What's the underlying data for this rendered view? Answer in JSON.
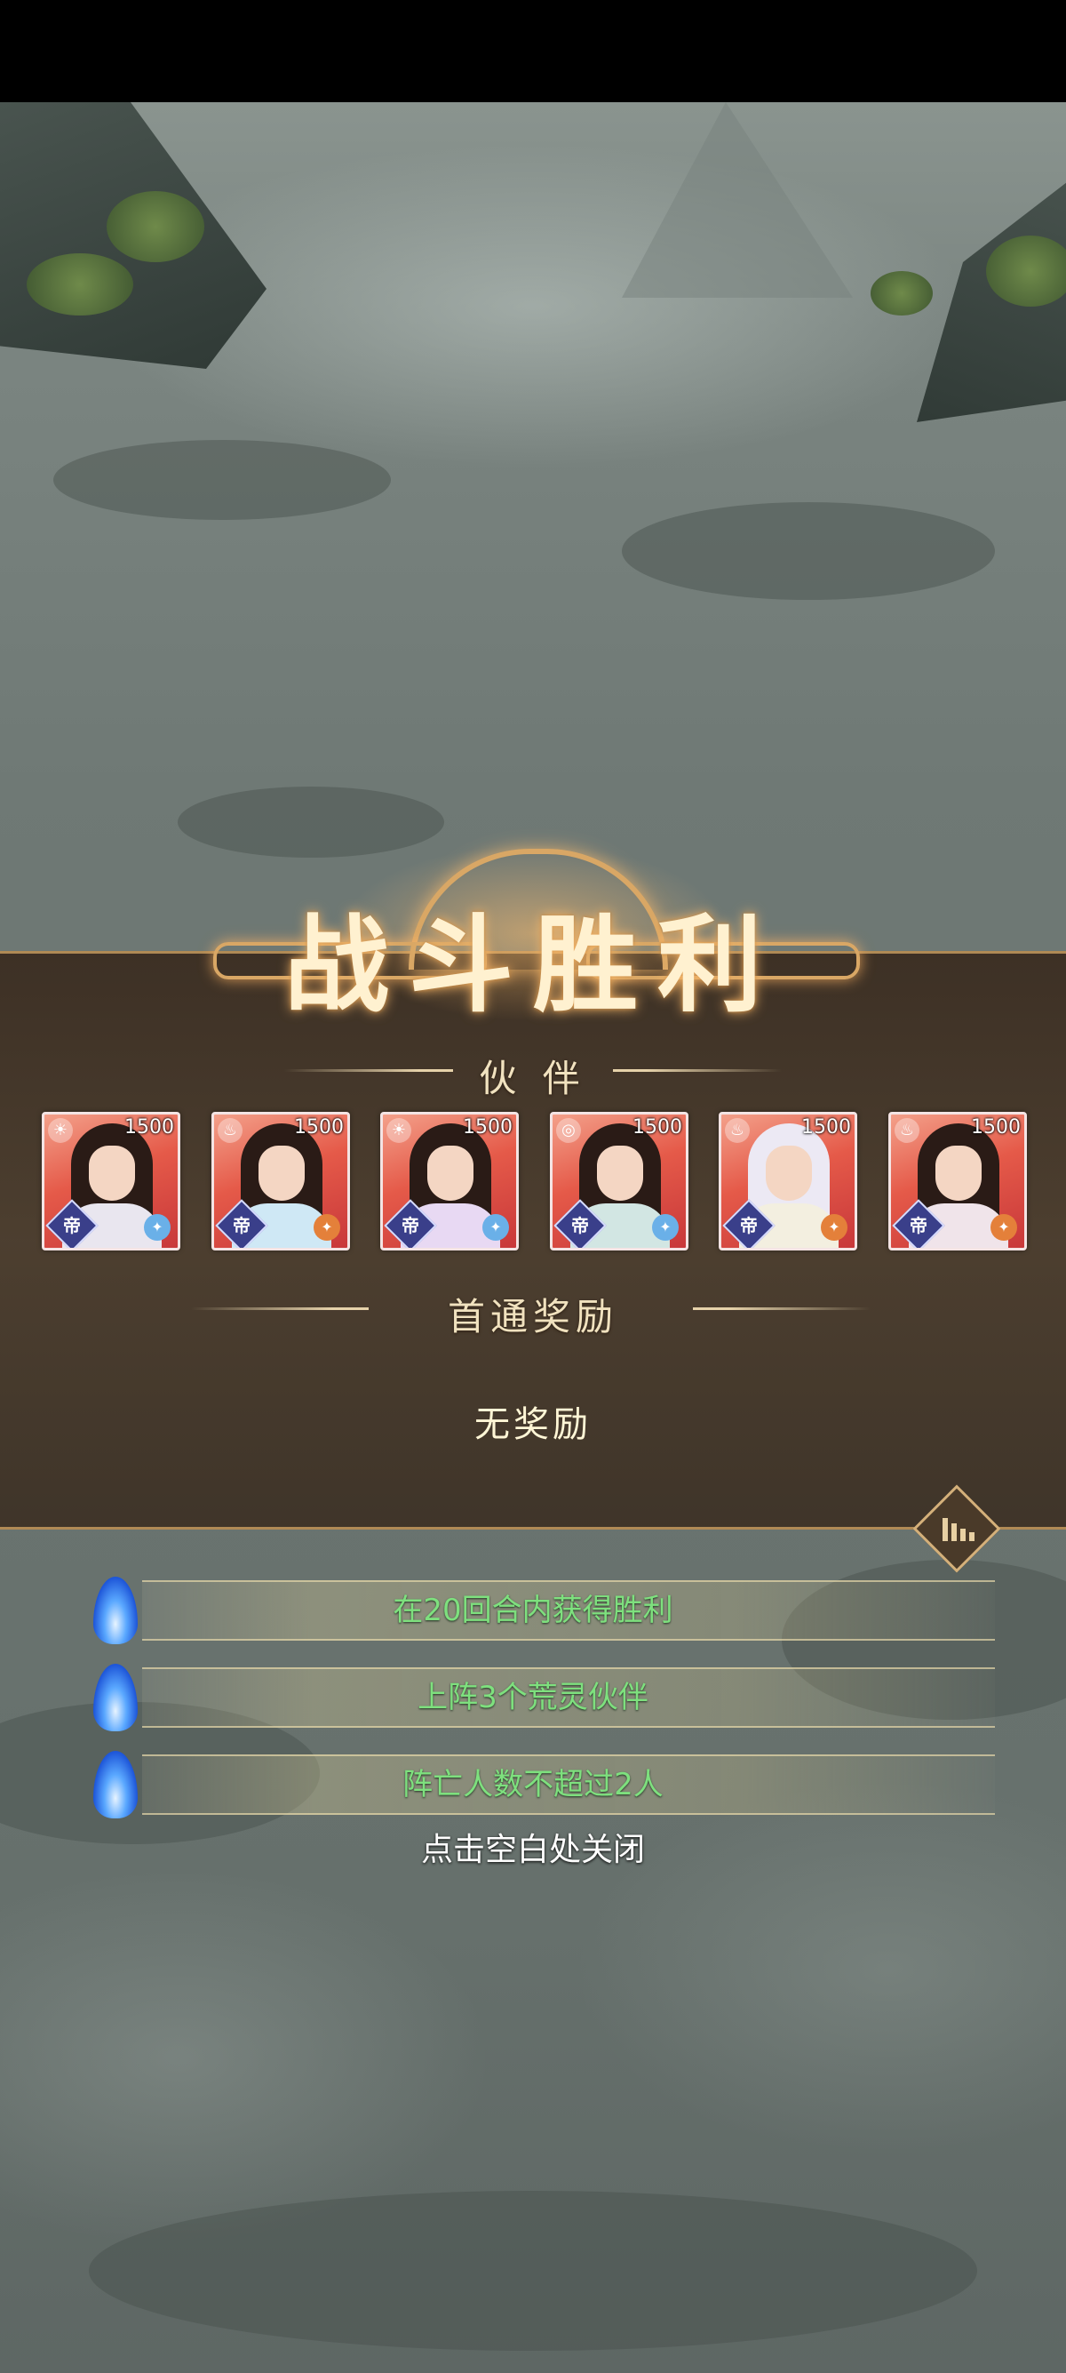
{
  "title": "战斗胜利",
  "partners": {
    "heading": "伙 伴",
    "cards": [
      {
        "power": "1500",
        "element_icon": "sun-icon",
        "rank": "帝",
        "star_color": "#6ab0e8"
      },
      {
        "power": "1500",
        "element_icon": "fire-icon",
        "rank": "帝",
        "star_color": "#e4803a"
      },
      {
        "power": "1500",
        "element_icon": "sun-icon",
        "rank": "帝",
        "star_color": "#6ab0e8"
      },
      {
        "power": "1500",
        "element_icon": "wind-icon",
        "rank": "帝",
        "star_color": "#6ab0e8"
      },
      {
        "power": "1500",
        "element_icon": "fire-icon",
        "rank": "帝",
        "star_color": "#e4803a"
      },
      {
        "power": "1500",
        "element_icon": "fire-icon",
        "rank": "帝",
        "star_color": "#e4803a"
      }
    ]
  },
  "first_clear": {
    "heading": "首通奖励",
    "empty_text": "无奖励"
  },
  "conditions": [
    {
      "text": "在20回合内获得胜利"
    },
    {
      "text": "上阵3个荒灵伙伴"
    },
    {
      "text": "阵亡人数不超过2人"
    }
  ],
  "close_hint": "点击空白处关闭",
  "colors": {
    "condition_text": "#7ee07e",
    "panel_border": "#b08a55",
    "title_glow": "#d9a765",
    "card_background": "#e55a49"
  }
}
